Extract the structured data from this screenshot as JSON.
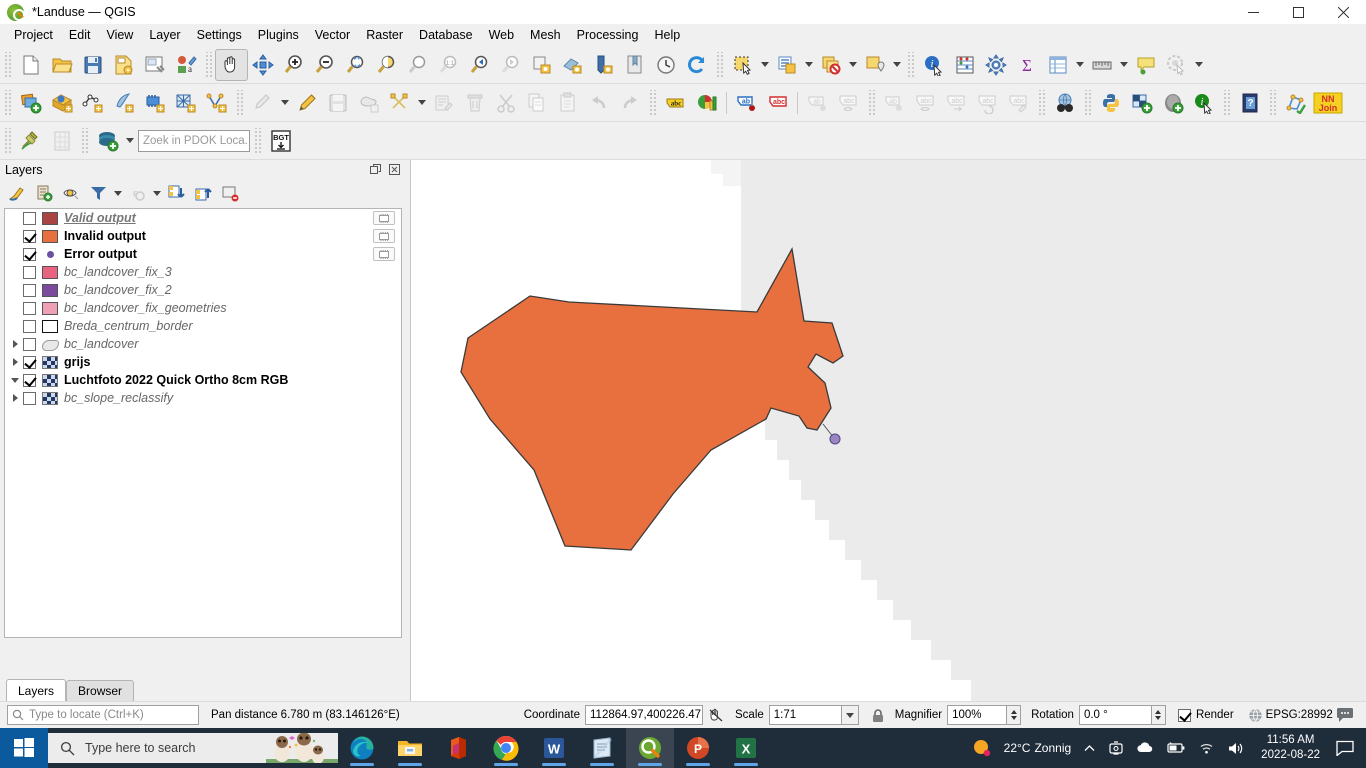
{
  "window": {
    "title": "*Landuse — QGIS",
    "logo_icon": "qgis-logo-icon",
    "minimize_label": "—",
    "maximize_label": "❐",
    "close_label": "✕"
  },
  "menubar": {
    "items": [
      {
        "label": "Project",
        "mnemonic": "P"
      },
      {
        "label": "Edit",
        "mnemonic": "E"
      },
      {
        "label": "View",
        "mnemonic": "V"
      },
      {
        "label": "Layer",
        "mnemonic": "L"
      },
      {
        "label": "Settings",
        "mnemonic": "S"
      },
      {
        "label": "Plugins",
        "mnemonic": "P"
      },
      {
        "label": "Vector",
        "mnemonic": "o"
      },
      {
        "label": "Raster",
        "mnemonic": "R"
      },
      {
        "label": "Database",
        "mnemonic": "D"
      },
      {
        "label": "Web",
        "mnemonic": "W"
      },
      {
        "label": "Mesh",
        "mnemonic": "M"
      },
      {
        "label": "Processing",
        "mnemonic": "c"
      },
      {
        "label": "Help",
        "mnemonic": "H"
      }
    ]
  },
  "toolbar_row1": {
    "icons": [
      "new-project-icon",
      "open-project-icon",
      "save-project-icon",
      "save-project-as-icon",
      "new-print-layout-icon",
      "style-manager-icon",
      "pan-map-icon",
      "pan-to-selection-icon",
      "zoom-in-icon",
      "zoom-out-icon",
      "zoom-full-icon",
      "zoom-to-selection-icon",
      "zoom-to-layer-icon",
      "zoom-native-icon",
      "zoom-last-icon",
      "zoom-next-icon",
      "refresh-layer-icon",
      "new-map-view-icon",
      "new-3d-map-view-icon",
      "bookmarks-icon",
      "temporal-controller-icon",
      "refresh-icon",
      "select-features-icon",
      "select-by-expression-icon",
      "deselect-features-icon",
      "identify-features-icon",
      "statistical-summary-icon",
      "options-icon",
      "sum-icon",
      "attribute-table-icon",
      "measure-line-icon",
      "map-tips-icon",
      "show-unplaced-labels-icon"
    ]
  },
  "toolbar_row2": {
    "icons": [
      "add-vector-layer-icon",
      "add-wms-layer-icon",
      "add-delimited-text-icon",
      "add-virtual-layer-icon",
      "add-mesh-layer-icon",
      "add-raster-layer-icon",
      "add-postgis-layer-icon",
      "current-edits-icon",
      "toggle-editing-icon",
      "save-layer-edits-icon",
      "add-polygon-feature-icon",
      "vertex-tool-icon",
      "modify-attributes-icon",
      "delete-selected-icon",
      "cut-features-icon",
      "copy-features-icon",
      "paste-features-icon",
      "undo-icon",
      "redo-icon",
      "label-icon",
      "diagram-icon",
      "pin-labels-icon",
      "highlight-labels-icon",
      "move-label-icon",
      "show-hide-labels-icon",
      "change-label-icon",
      "rotate-label-icon",
      "edit-label-icon",
      "metasearch-icon",
      "python-console-icon",
      "plugin-manager-icon",
      "postgis-manager-icon",
      "info-plugin-icon",
      "help-icon",
      "nn-join-icon"
    ]
  },
  "toolbar_row3": {
    "icons": [
      "georeferencer-icon",
      "raster-calculator-icon",
      "pdok-services-icon"
    ],
    "pdok_placeholder": "Zoek in PDOK Loca...",
    "bgt_icon": "bgt-download-icon"
  },
  "layers_panel": {
    "title": "Layers",
    "undock_icon": "undock-panel-icon",
    "close_icon": "close-panel-icon",
    "toolbar_icons": [
      "open-layer-styling-icon",
      "add-group-icon",
      "manage-map-themes-icon",
      "filter-legend-icon",
      "filter-legend-expression-icon",
      "expand-all-icon",
      "collapse-all-icon",
      "remove-layer-icon"
    ],
    "layers": [
      {
        "name": "Valid output",
        "checked": false,
        "style": "boldital",
        "symbol": "fill",
        "color": "#a94442",
        "expander": "none",
        "chip": true
      },
      {
        "name": "Invalid output",
        "checked": true,
        "style": "bold",
        "symbol": "fill",
        "color": "#e8703f",
        "expander": "none",
        "chip": true
      },
      {
        "name": "Error output",
        "checked": true,
        "style": "bold",
        "symbol": "point",
        "color": "#6b4fa0",
        "expander": "none",
        "chip": true
      },
      {
        "name": "bc_landcover_fix_3",
        "checked": false,
        "style": "ital",
        "symbol": "fill",
        "color": "#e8637f",
        "expander": "none",
        "chip": false
      },
      {
        "name": "bc_landcover_fix_2",
        "checked": false,
        "style": "ital",
        "symbol": "fill",
        "color": "#7b4a9e",
        "expander": "none",
        "chip": false
      },
      {
        "name": "bc_landcover_fix_geometries",
        "checked": false,
        "style": "ital",
        "symbol": "fill",
        "color": "#f0a0b4",
        "expander": "none",
        "chip": false
      },
      {
        "name": "Breda_centrum_border",
        "checked": false,
        "style": "ital",
        "symbol": "outline",
        "color": "#ffffff",
        "expander": "none",
        "chip": false
      },
      {
        "name": "bc_landcover",
        "checked": false,
        "style": "ital",
        "symbol": "blob",
        "color": "#e8e8e8",
        "expander": "right",
        "chip": false
      },
      {
        "name": "grijs",
        "checked": true,
        "style": "bold",
        "symbol": "raster",
        "color": "#1f3864",
        "expander": "right",
        "chip": false
      },
      {
        "name": "Luchtfoto 2022 Quick Ortho 8cm RGB",
        "checked": true,
        "style": "bold",
        "symbol": "raster",
        "color": "#1f3864",
        "expander": "down",
        "chip": false
      },
      {
        "name": "bc_slope_reclassify",
        "checked": false,
        "style": "ital",
        "symbol": "raster",
        "color": "#1f3864",
        "expander": "right",
        "chip": false
      }
    ],
    "tabs": [
      {
        "label": "Layers",
        "selected": true
      },
      {
        "label": "Browser",
        "selected": false
      }
    ]
  },
  "map": {
    "background_color": "#ffffff",
    "ortho_color": "#ebebeb",
    "polygon_fill": "#e8703f",
    "polygon_stroke": "#3a3a3a",
    "error_point_color": "#9a86c4",
    "error_point_stroke": "#5a4a80"
  },
  "statusbar": {
    "locate_placeholder": "Type to locate (Ctrl+K)",
    "locate_icon": "search-icon",
    "pan_distance": "Pan distance 6.780 m (83.146126°E)",
    "coordinate_label": "Coordinate",
    "coordinate_value": "112864.97,400226.47",
    "coordinate_toggle_icon": "toggle-mouse-coordinate-icon",
    "scale_label": "Scale",
    "scale_value": "1:71",
    "lock_icon": "lock-scale-icon",
    "magnifier_label": "Magnifier",
    "magnifier_value": "100%",
    "rotation_label": "Rotation",
    "rotation_value": "0.0 °",
    "render_label": "Render",
    "render_checked": true,
    "crs_label": "EPSG:28992",
    "crs_icon": "globe-icon",
    "messages_icon": "messages-log-icon"
  },
  "taskbar": {
    "start_icon": "windows-start-icon",
    "search_placeholder": "Type here to search",
    "search_icon": "search-icon",
    "apps": [
      {
        "name": "edge-icon",
        "running": true,
        "selected": false
      },
      {
        "name": "file-explorer-icon",
        "running": true,
        "selected": false
      },
      {
        "name": "office-icon",
        "running": false,
        "selected": false
      },
      {
        "name": "chrome-icon",
        "running": true,
        "selected": false
      },
      {
        "name": "word-icon",
        "running": true,
        "selected": false
      },
      {
        "name": "notepad-icon",
        "running": true,
        "selected": false
      },
      {
        "name": "qgis-icon",
        "running": true,
        "selected": true
      },
      {
        "name": "powerpoint-icon",
        "running": true,
        "selected": false
      },
      {
        "name": "excel-icon",
        "running": true,
        "selected": false
      }
    ],
    "weather_temp": "22°C",
    "weather_text": "Zonnig",
    "weather_icon": "sun-icon",
    "tray_icons": [
      "chevron-up-icon",
      "onedrive-sync-icon",
      "cloud-icon",
      "battery-icon",
      "wifi-icon",
      "volume-icon"
    ],
    "time": "11:56 AM",
    "date": "2022-08-22",
    "action_center_icon": "action-center-icon"
  }
}
